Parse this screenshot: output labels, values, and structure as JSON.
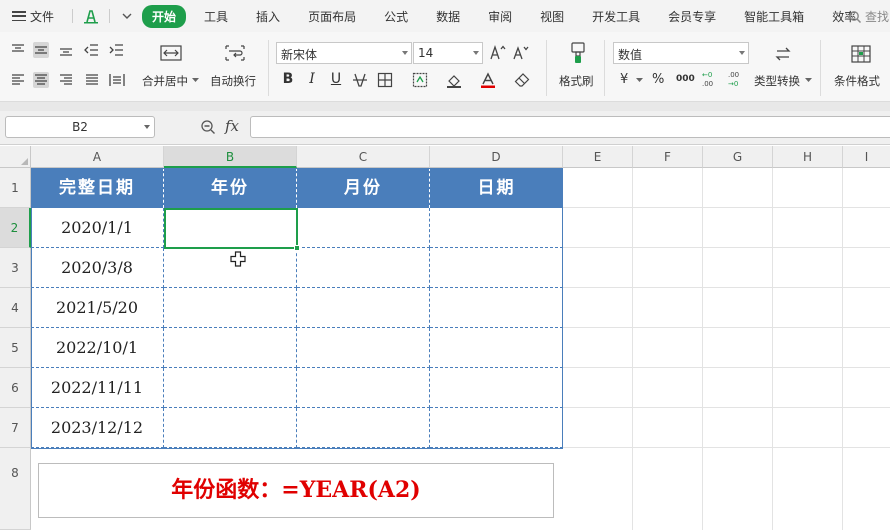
{
  "menu": {
    "file_label": "文件",
    "tabs": [
      "开始",
      "工具",
      "插入",
      "页面布局",
      "公式",
      "数据",
      "审阅",
      "视图",
      "开发工具",
      "会员专享",
      "智能工具箱",
      "效率"
    ],
    "active_tab": "开始",
    "search_label": "查找"
  },
  "ribbon": {
    "merge_center": "合并居中",
    "wrap_text": "自动换行",
    "font_name": "新宋体",
    "font_size": "14",
    "bold": "B",
    "italic": "I",
    "underline": "U",
    "format_painter": "格式刷",
    "number_format": "数值",
    "currency": "¥",
    "percent": "%",
    "thousands": "000",
    "dec_increase": "+0\n.00",
    "dec_decrease": "-.00\n+.0",
    "type_convert": "类型转换",
    "conditional_format": "条件格式"
  },
  "formula_bar": {
    "name_box": "B2",
    "fx": "fx",
    "formula": ""
  },
  "sheet": {
    "columns": [
      "A",
      "B",
      "C",
      "D",
      "E",
      "F",
      "G",
      "H",
      "I"
    ],
    "rows": [
      "1",
      "2",
      "3",
      "4",
      "5",
      "6",
      "7",
      "8"
    ],
    "selected_column": "B",
    "selected_row": "2",
    "headers": [
      "完整日期",
      "年份",
      "月份",
      "日期"
    ],
    "dates": [
      "2020/1/1",
      "2020/3/8",
      "2021/5/20",
      "2022/10/1",
      "2022/11/11",
      "2023/12/12"
    ],
    "note": "年份函数：=YEAR(A2)"
  },
  "colors": {
    "accent_green": "#1e9e4b",
    "header_blue": "#4a7ebb",
    "note_red": "#e00000"
  }
}
